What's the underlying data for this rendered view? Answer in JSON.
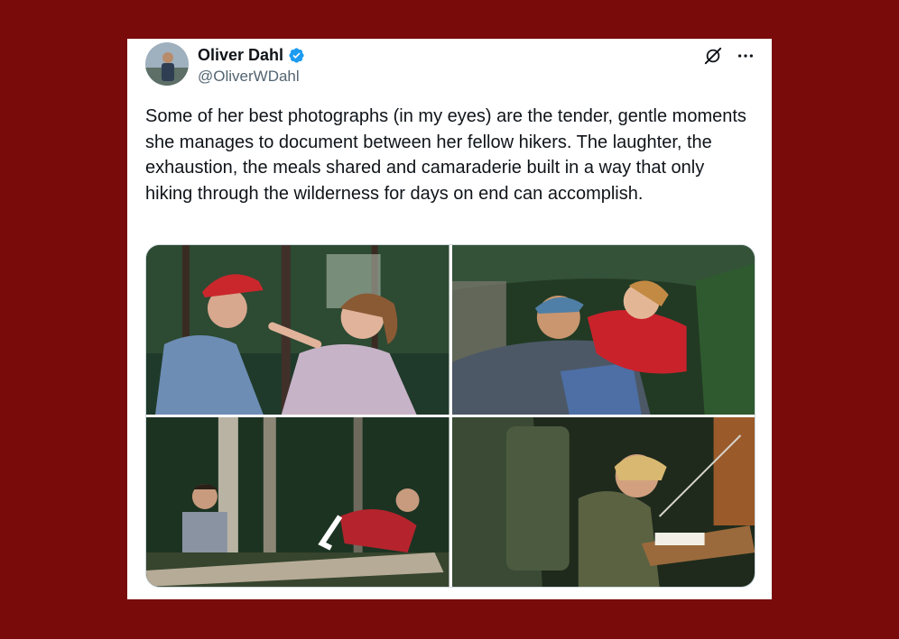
{
  "tweet": {
    "author_name": "Oliver Dahl",
    "author_handle": "@OliverWDahl",
    "verified": true,
    "text": "Some of her best photographs (in my eyes) are the tender, gentle moments she manages to document between her fellow hikers. The laughter, the exhaustion, the meals shared and camaraderie built in a way that only hiking through the wilderness for days on end can accomplish."
  },
  "icons": {
    "verified": "verified-badge-icon",
    "grok": "grok-icon",
    "more": "more-options-icon"
  },
  "colors": {
    "background": "#7a0b0b",
    "verified_blue": "#1d9bf0",
    "text": "#0f1419",
    "secondary_text": "#536471"
  },
  "media": {
    "photos": [
      "older man in red cap, woman touching his face in forest",
      "smiling man in bandana lying with woman in red jacket",
      "boy in plaid shirt sitting on log, person lounging on log",
      "boy with backpack writing at wooden table"
    ]
  }
}
